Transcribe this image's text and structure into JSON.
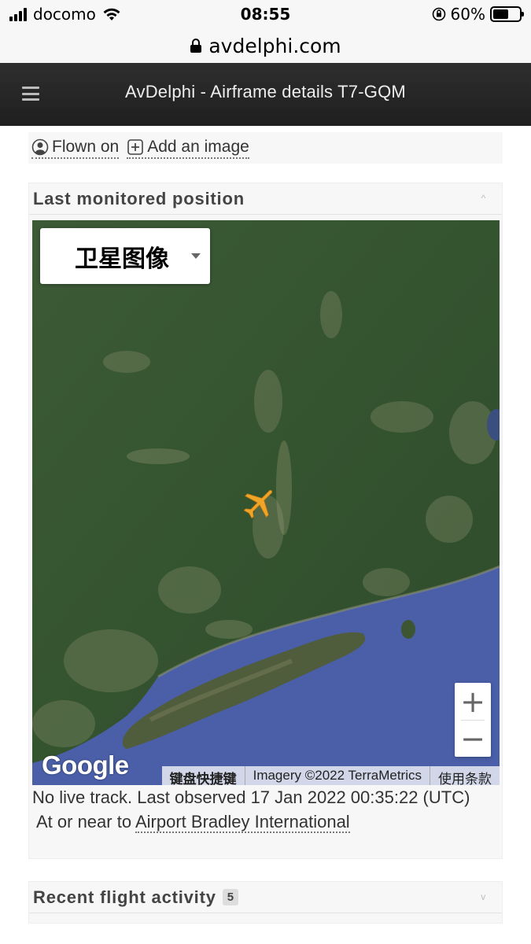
{
  "status_bar": {
    "carrier": "docomo",
    "time": "08:55",
    "battery": "60%",
    "battery_level": 0.6
  },
  "browser": {
    "url": "avdelphi.com"
  },
  "header": {
    "title": "AvDelphi - Airframe details T7-GQM",
    "menu_icon": "hamburger-icon"
  },
  "actions": {
    "flown_on": "Flown on",
    "add_image": "Add an image"
  },
  "position_panel": {
    "title": "Last monitored position",
    "caret": "^",
    "map": {
      "type_selector": "卫星图像",
      "zoom_in": "+",
      "zoom_out": "−",
      "logo": "Google",
      "keyboard_shortcuts": "键盘快捷键",
      "imagery": "Imagery ©2022 TerraMetrics",
      "terms": "使用条款"
    },
    "status_line": "No live track. Last observed 17 Jan 2022 00:35:22 (UTC)",
    "near_prefix": "At or near to",
    "near_airport": "Airport Bradley International"
  },
  "activity_panel": {
    "title": "Recent flight activity",
    "count": "5",
    "caret": "v"
  },
  "colors": {
    "header_bg": "#262626",
    "panel_bg": "#f7f7f7",
    "plane": "#f0a428",
    "water": "#4a5fa8"
  }
}
